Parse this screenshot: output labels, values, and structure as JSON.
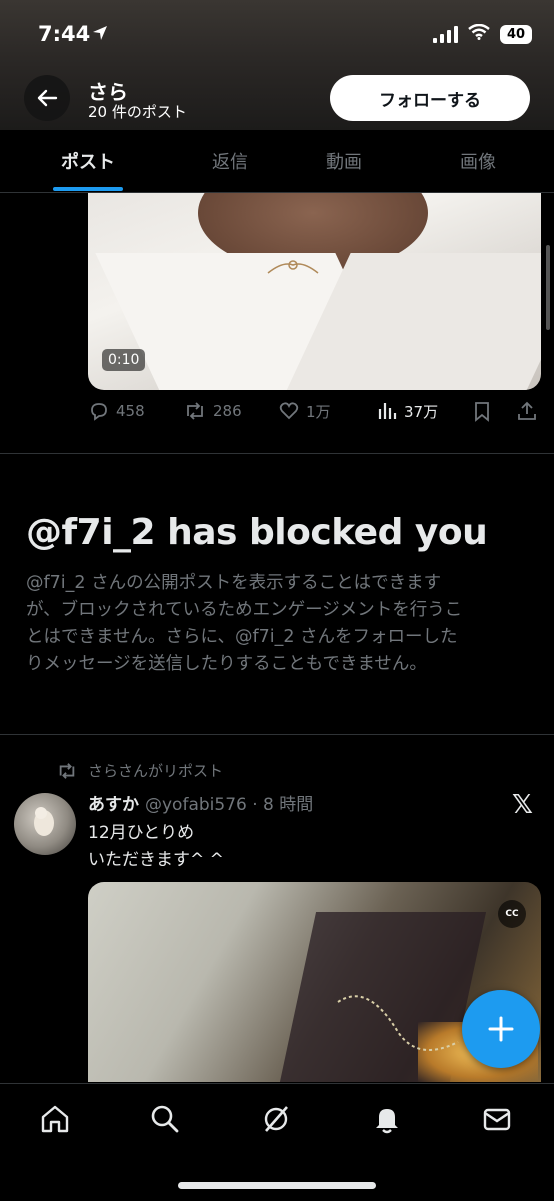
{
  "status_bar": {
    "time": "7:44",
    "battery": "40"
  },
  "header": {
    "name": "さら",
    "post_count": "20 件のポスト",
    "follow_label": "フォローする"
  },
  "tabs": [
    {
      "label": "ポスト",
      "active": true
    },
    {
      "label": "返信",
      "active": false
    },
    {
      "label": "動画",
      "active": false
    },
    {
      "label": "画像",
      "active": false
    }
  ],
  "video_post": {
    "duration": "0:10",
    "replies": "458",
    "reposts": "286",
    "likes": "1万",
    "views": "37万"
  },
  "blocked": {
    "title": "@f7i_2 has blocked you",
    "lines": [
      "@f7i_2 さんの公開ポストを表示することはできます",
      "が、ブロックされているためエンゲージメントを行うこ",
      "とはできません。さらに、@f7i_2 さんをフォローした",
      "りメッセージを送信したりすることもできません。"
    ]
  },
  "repost": {
    "label": "さらさんがリポスト",
    "name": "あすか",
    "handle": "@yofabi576 · 8 時間",
    "line1": "12月ひとりめ",
    "line2": "いただきます^ ^",
    "cc": "CC"
  },
  "colors": {
    "accent": "#1d9bf0",
    "muted": "#71767b",
    "text": "#e7e9ea"
  },
  "bottom_nav": [
    "home-icon",
    "search-icon",
    "grok-icon",
    "notifications-icon",
    "messages-icon"
  ]
}
